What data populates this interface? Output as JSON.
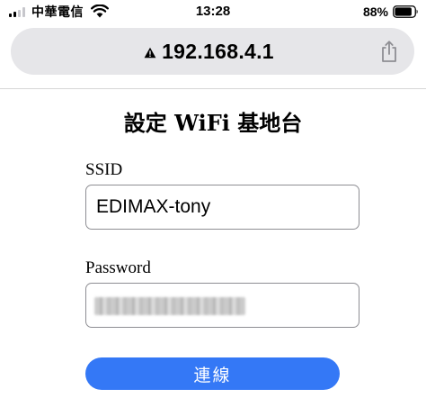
{
  "status_bar": {
    "carrier": "中華電信",
    "time": "13:28",
    "battery_percent": "88%",
    "battery_level": 0.88,
    "signal_bars_filled": 2,
    "signal_bars_total": 4,
    "icons": [
      "cellular-signal-icon",
      "wifi-icon",
      "battery-icon"
    ]
  },
  "address_bar": {
    "url": "192.168.4.1",
    "security_icon": "warning-triangle-icon",
    "action_icon": "share-icon"
  },
  "form": {
    "title": "設定 WiFi 基地台",
    "ssid_label": "SSID",
    "ssid_value": "EDIMAX-tony",
    "password_label": "Password",
    "password_value_obscured": true,
    "submit_label": "連線"
  },
  "colors": {
    "accent": "#3478f6",
    "address_bar_bg": "#e6e6e9",
    "field_border": "#8e8e93"
  }
}
